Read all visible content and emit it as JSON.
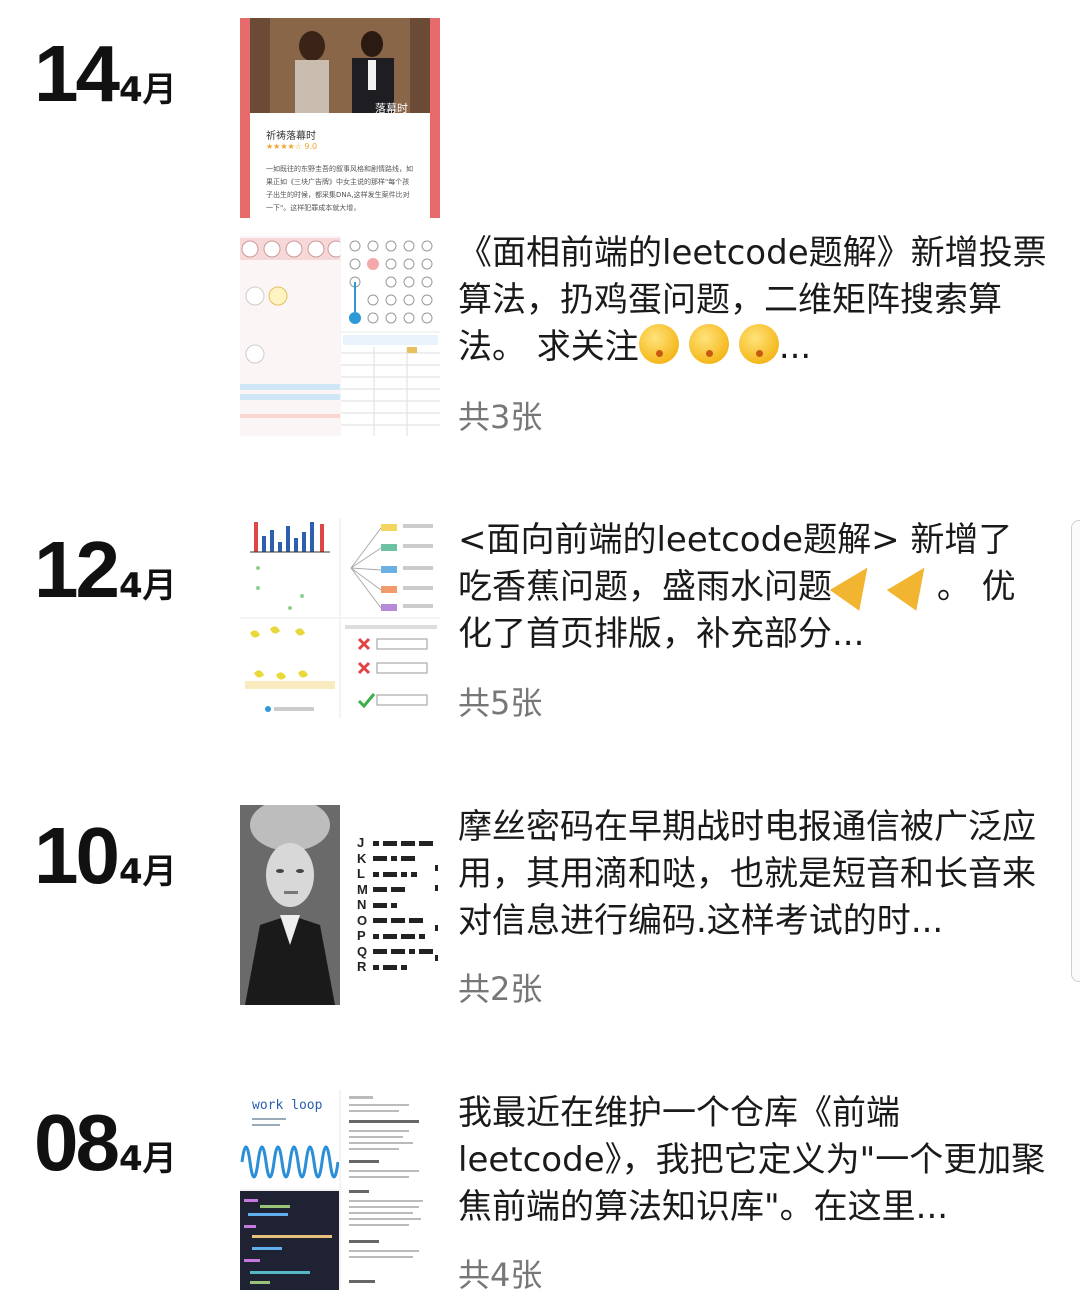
{
  "posts": [
    {
      "day": "14",
      "month": "4月",
      "text": "《面相前端的leetcode题解》新增投票算法，扔鸡蛋问题，二维矩阵搜索算法。 求关注",
      "more": "...",
      "count": "共3张",
      "thumb_title": "祈祷落幕时",
      "thumb_rating": "★★★★☆ 9.0",
      "thumb_caption": "落幕时",
      "thumb_desc": "一如既往的东野圭吾的叙事风格和剧情路线，如果正如《三块广告牌》中女主说的那样\"每个孩子出生的时候，都采集DNA,这样发生案件比对一下\"。这样犯罪成本就大增，"
    },
    {
      "day": "12",
      "month": "4月",
      "text": "<面向前端的leetcode题解> 新增了 吃香蕉问题，盛雨水问题",
      "text2": "。 优化了首页排版，补充部分",
      "more": "...",
      "count": "共5张"
    },
    {
      "day": "10",
      "month": "4月",
      "text": "摩丝密码在早期战时电报通信被广泛应用，其用滴和哒，也就是短音和长音来对信息进行编码.这样考试的时",
      "more": "...",
      "count": "共2张",
      "morse_letters": [
        "J",
        "K",
        "L",
        "M",
        "N",
        "O",
        "P",
        "Q",
        "R"
      ]
    },
    {
      "day": "08",
      "month": "4月",
      "text": "我最近在维护一个仓库《前端leetcode》，我把它定义为\"一个更加聚焦前端的算法知识库\"。在这里",
      "more": "...",
      "count": "共4张",
      "thumb_title": "work loop"
    }
  ]
}
